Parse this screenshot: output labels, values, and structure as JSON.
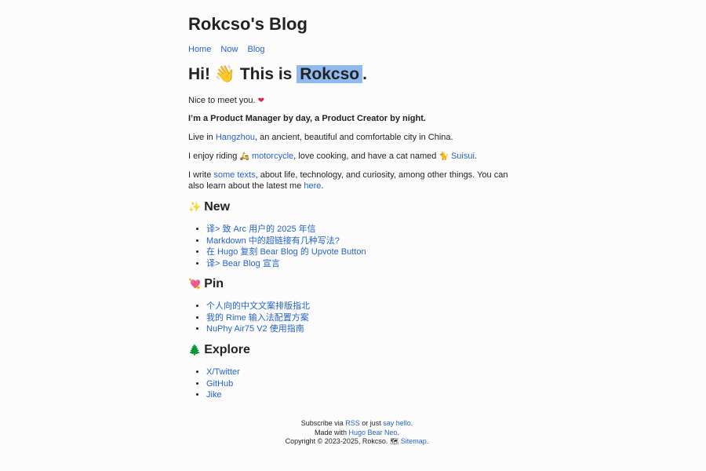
{
  "site": {
    "title": "Rokcso's Blog",
    "nav": [
      "Home",
      "Now",
      "Blog"
    ]
  },
  "hero": {
    "prefix": "Hi!",
    "wave_icon": "👋",
    "mid": "This is",
    "name": "Rokcso",
    "suffix": "."
  },
  "intro": {
    "greet": "Nice to meet you.",
    "heart_icon": "❤",
    "bold_line": "I’m a Product Manager by day, a Product Creator by night.",
    "live_pre": "Live in ",
    "live_link": "Hangzhou",
    "live_post": ", an ancient, beautiful and comfortable city in China.",
    "riding_pre": "I enjoy riding ",
    "motorcycle_icon": "🛵",
    "riding_link": "motorcycle",
    "riding_mid": ", love cooking, and have a cat named ",
    "cat_icon": "🐈",
    "cat_link": "Suisui",
    "riding_post": ".",
    "write_pre": "I write ",
    "write_link": "some texts",
    "write_mid": ", about life, technology, and curiosity, among other things. You can also learn about the latest me ",
    "write_link2": "here",
    "write_post": "."
  },
  "sections": {
    "new": {
      "icon": "✨",
      "title": "New",
      "items": [
        "译> 致 Arc 用户的 2025 年信",
        "Markdown 中的超链接有几种写法?",
        "在 Hugo 复刻 Bear Blog 的 Upvote Button",
        "译> Bear Blog 宣言"
      ]
    },
    "pin": {
      "icon": "💘",
      "title": "Pin",
      "items": [
        "个人向的中文文案排版指北",
        "我的 Rime 输入法配置方案",
        "NuPhy Air75 V2 使用指南"
      ]
    },
    "explore": {
      "icon": "🌲",
      "title": "Explore",
      "items": [
        "X/Twitter",
        "GitHub",
        "Jike"
      ]
    }
  },
  "footer": {
    "sub_pre": "Subscribe via ",
    "rss": "RSS",
    "sub_mid": " or just ",
    "hello": "say hello",
    "sub_post": ".",
    "made_pre": "Made with ",
    "theme": "Hugo Bear Neo",
    "made_post": ".",
    "copyright": "Copyright © 2023-2025, Rokcso. ",
    "sitemap_icon": "🗺",
    "sitemap": "Sitemap",
    "end": "."
  },
  "colors": {
    "link": "#2563c9",
    "highlight": "#8fbaf0",
    "text": "#222222",
    "background": "#fcfcfc"
  }
}
